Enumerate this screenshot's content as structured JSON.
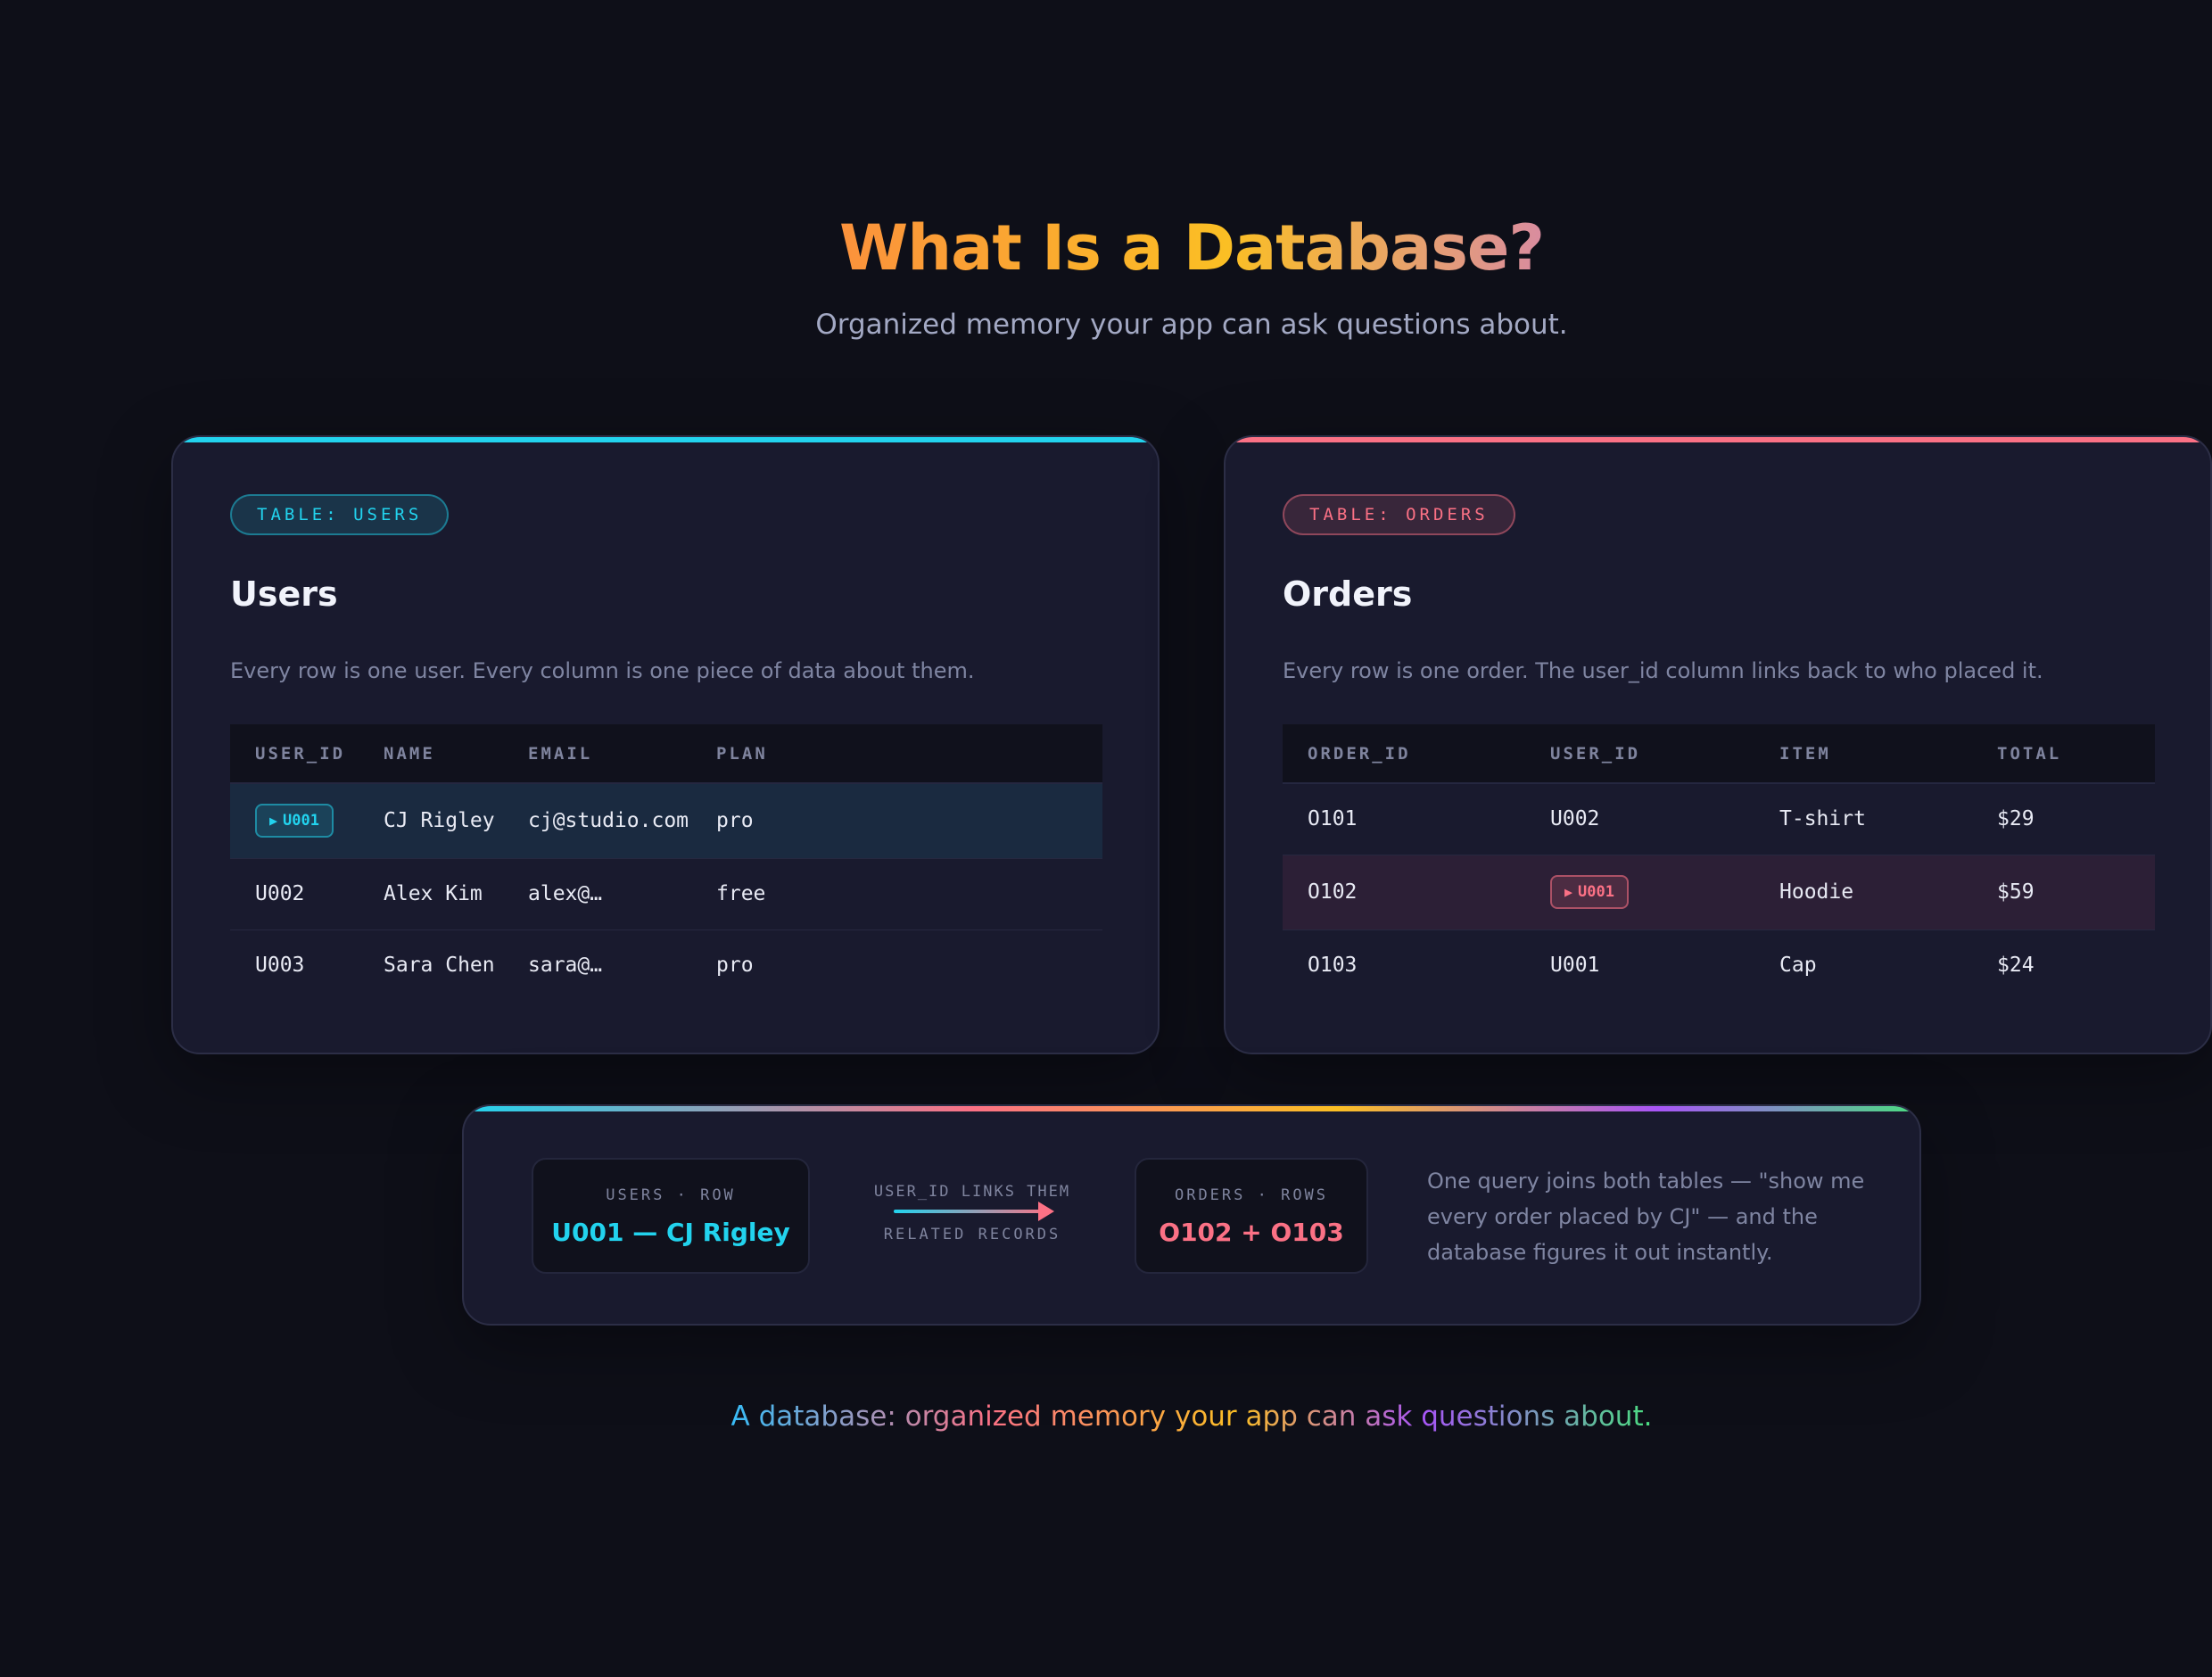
{
  "header": {
    "title": "What Is a Database?",
    "subtitle": "Organized memory your app can ask questions about."
  },
  "users_table": {
    "badge": "TABLE: USERS",
    "title": "Users",
    "description": "Every row is one user. Every column is one piece of data about them.",
    "columns": [
      "USER_ID",
      "NAME",
      "EMAIL",
      "PLAN"
    ],
    "rows": [
      [
        "U001",
        "CJ Rigley",
        "cj@studio.com",
        "pro"
      ],
      [
        "U002",
        "Alex Kim",
        "alex@…",
        "free"
      ],
      [
        "U003",
        "Sara Chen",
        "sara@…",
        "pro"
      ]
    ],
    "accent": "#22d3ee"
  },
  "orders_table": {
    "badge": "TABLE: ORDERS",
    "title": "Orders",
    "description": "Every row is one order. The user_id column links back to who placed it.",
    "columns": [
      "ORDER_ID",
      "USER_ID",
      "ITEM",
      "TOTAL"
    ],
    "rows": [
      [
        "O101",
        "U002",
        "T-shirt",
        "$29"
      ],
      [
        "O102",
        "U001",
        "Hoodie",
        "$59"
      ],
      [
        "O103",
        "U001",
        "Cap",
        "$24"
      ]
    ],
    "accent": "#fb7185"
  },
  "join": {
    "users_label": "USERS · ROW",
    "users_value": "U001 — CJ Rigley",
    "link_top": "USER_ID LINKS THEM",
    "link_bottom": "RELATED RECORDS",
    "orders_label": "ORDERS · ROWS",
    "orders_value": "O102 + O103",
    "description": "One query joins both tables — \"show me every order placed by CJ\" — and the database figures it out instantly."
  },
  "footer": {
    "text": "A database: organized memory your app can ask questions about."
  },
  "icons": {
    "row_marker": "play-triangle-icon"
  }
}
